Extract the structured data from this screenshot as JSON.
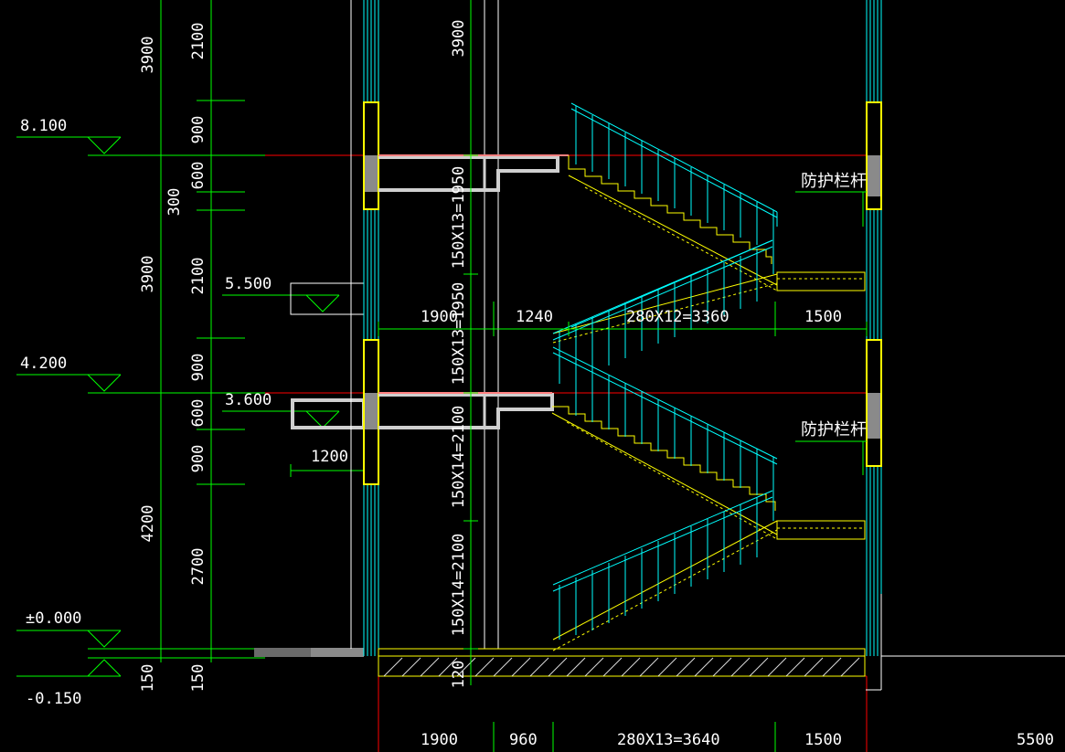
{
  "colors": {
    "background": "#000000",
    "dimension": "#00ff00",
    "wall": "#00ffff",
    "stair": "#ffff00",
    "axis": "#ff0000",
    "slab": "#ff8080",
    "concrete": "#8a8a8a",
    "text": "#ffffff"
  },
  "levels": {
    "l8100": "8.100",
    "l5500": "5.500",
    "l4200": "4.200",
    "l3600": "3.600",
    "l0000": "±0.000",
    "lm0150": "-0.150"
  },
  "dims_outer": {
    "d3900_top": "3900",
    "d3900_mid": "3900",
    "d4200": "4200",
    "d150": "150"
  },
  "dims_inner": {
    "d2100_top": "2100",
    "d900_a": "900",
    "d600_a": "600",
    "d300": "300",
    "d2100_mid": "2100",
    "d900_b": "900",
    "d600_b": "600",
    "d900_c": "900",
    "d2700": "2700",
    "d150": "150"
  },
  "canopy": {
    "d1200": "1200"
  },
  "stair_dims": {
    "d3900": "3900",
    "flight4": "150X13=1950",
    "flight3": "150X13=1950",
    "flight2": "150X14=2100",
    "flight1": "150X14=2100",
    "d120": "120"
  },
  "plan_dims": {
    "d1900": "1900",
    "d1240": "1240",
    "d3360": "280X12=3360",
    "d1500": "1500"
  },
  "bottom_dims": {
    "d1900": "1900",
    "d960": "960",
    "d3640": "280X13=3640",
    "d1500": "1500",
    "d5500": "5500"
  },
  "notes": {
    "railing_upper": "防护栏杆",
    "railing_lower": "防护栏杆"
  }
}
